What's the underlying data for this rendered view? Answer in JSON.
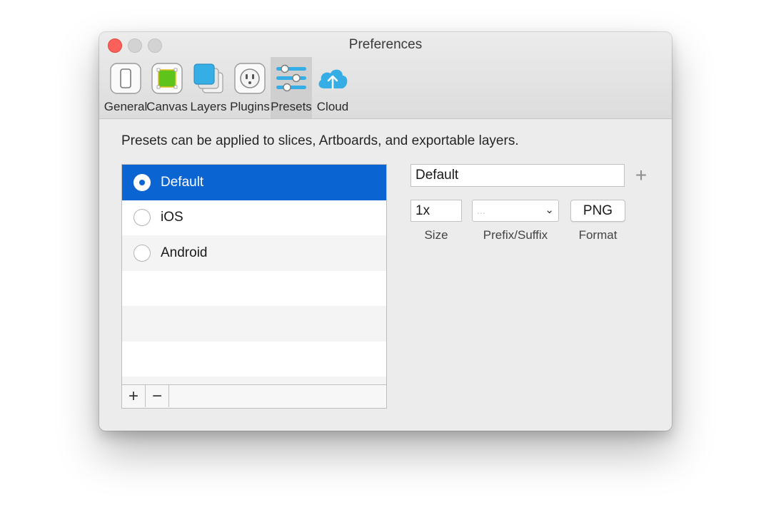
{
  "window": {
    "title": "Preferences"
  },
  "toolbar": {
    "items": [
      {
        "label": "General",
        "icon": "phone-icon"
      },
      {
        "label": "Canvas",
        "icon": "canvas-icon"
      },
      {
        "label": "Layers",
        "icon": "layers-icon"
      },
      {
        "label": "Plugins",
        "icon": "plug-icon"
      },
      {
        "label": "Presets",
        "icon": "sliders-icon",
        "selected": true
      },
      {
        "label": "Cloud",
        "icon": "cloud-upload-icon"
      }
    ]
  },
  "presets": {
    "description": "Presets can be applied to slices, Artboards, and exportable layers.",
    "items": [
      {
        "label": "Default",
        "selected": true
      },
      {
        "label": "iOS"
      },
      {
        "label": "Android"
      }
    ],
    "add_label": "+",
    "remove_label": "−"
  },
  "editor": {
    "name_value": "Default",
    "add_label": "+",
    "size_value": "1x",
    "prefix_placeholder": "...",
    "format_value": "PNG",
    "size_caption": "Size",
    "prefix_caption": "Prefix/Suffix",
    "format_caption": "Format"
  },
  "colors": {
    "selection": "#0a64d2",
    "close_button": "#fc605b",
    "canvas_green": "#5ec41b",
    "icon_blue": "#35aee6"
  }
}
